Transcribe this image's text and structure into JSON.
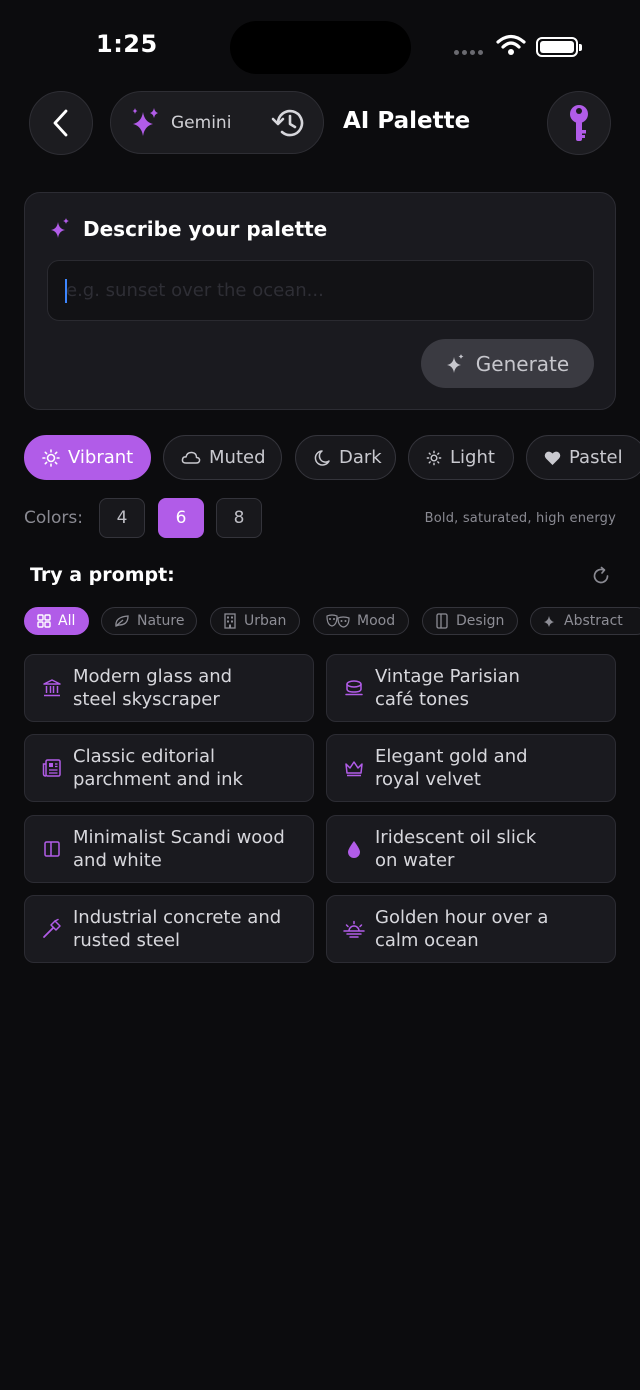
{
  "status_bar": {
    "time": "1:25"
  },
  "header": {
    "model_label": "Gemini",
    "title": "AI Palette",
    "icons": {
      "back": "chevron-left-icon",
      "model": "sparkles-icon",
      "history": "history-icon",
      "key": "key-icon"
    }
  },
  "describe": {
    "title": "Describe your palette",
    "input_value": "",
    "input_placeholder": "e.g. sunset over the ocean...",
    "generate_label": "Generate"
  },
  "styles": [
    {
      "label": "Vibrant",
      "icon": "sun-icon",
      "active": true
    },
    {
      "label": "Muted",
      "icon": "cloud-icon",
      "active": false
    },
    {
      "label": "Dark",
      "icon": "moon-icon",
      "active": false
    },
    {
      "label": "Light",
      "icon": "sun-small-icon",
      "active": false
    },
    {
      "label": "Pastel",
      "icon": "heart-icon",
      "active": false
    }
  ],
  "colors": {
    "label": "Colors:",
    "options": [
      "4",
      "6",
      "8"
    ],
    "selected": "6",
    "description": "Bold, saturated, high energy"
  },
  "try_prompt": {
    "title": "Try a prompt:",
    "categories": [
      {
        "label": "All",
        "icon": "grid-icon",
        "active": true
      },
      {
        "label": "Nature",
        "icon": "leaf-icon",
        "active": false
      },
      {
        "label": "Urban",
        "icon": "building-icon",
        "active": false
      },
      {
        "label": "Mood",
        "icon": "masks-icon",
        "active": false
      },
      {
        "label": "Design",
        "icon": "ruler-icon",
        "active": false
      },
      {
        "label": "Abstract",
        "icon": "sparkle-icon",
        "active": false
      }
    ],
    "prompts": [
      {
        "text": "Modern glass and\nsteel skyscraper",
        "icon": "bank-icon"
      },
      {
        "text": "Vintage Parisian\ncafé tones",
        "icon": "coffee-icon"
      },
      {
        "text": "Classic editorial\nparchment and ink",
        "icon": "newspaper-icon"
      },
      {
        "text": "Elegant gold and\nroyal velvet",
        "icon": "crown-icon"
      },
      {
        "text": "Minimalist Scandi wood\nand white",
        "icon": "panel-icon"
      },
      {
        "text": "Iridescent oil slick\non water",
        "icon": "drop-icon"
      },
      {
        "text": "Industrial concrete and\nrusted steel",
        "icon": "hammer-icon"
      },
      {
        "text": "Golden hour over a\ncalm ocean",
        "icon": "sunset-icon"
      }
    ]
  },
  "colors_theme": {
    "accent": "#b15ce8",
    "background": "#0c0c0e",
    "card": "#1a1a1f"
  }
}
